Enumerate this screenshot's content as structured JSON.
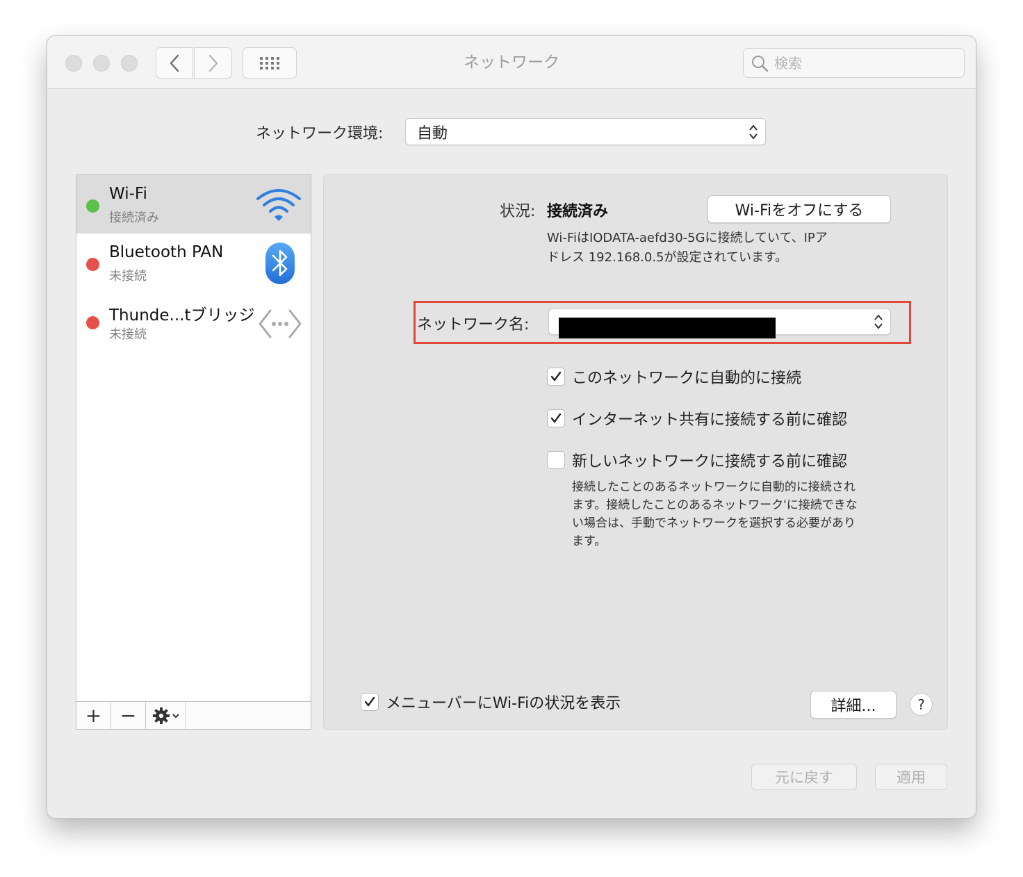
{
  "window": {
    "title": "ネットワーク"
  },
  "search": {
    "placeholder": "検索"
  },
  "location": {
    "label": "ネットワーク環境:",
    "value": "自動"
  },
  "services": [
    {
      "name": "Wi-Fi",
      "status": "接続済み",
      "dot_color": "#5cc04a",
      "icon": "wifi-icon"
    },
    {
      "name": "Bluetooth PAN",
      "status": "未接続",
      "dot_color": "#e5514a",
      "icon": "bluetooth-icon"
    },
    {
      "name": "Thunde...tブリッジ",
      "status": "未接続",
      "dot_color": "#e5514a",
      "icon": "ethernet-bridge-icon"
    }
  ],
  "sidebar_toolbar": {
    "add": "+",
    "remove": "−"
  },
  "detail": {
    "status_label": "状況:",
    "status_value": "接続済み",
    "wifi_off_button": "Wi-Fiをオフにする",
    "status_desc_line1": "Wi-FiはIODATA-aefd30-5Gに接続していて、IPア",
    "status_desc_line2": "ドレス 192.168.0.5が設定されています。",
    "network_name_label": "ネットワーク名:",
    "options": [
      {
        "label": "このネットワークに自動的に接続",
        "checked": true
      },
      {
        "label": "インターネット共有に接続する前に確認",
        "checked": true
      },
      {
        "label": "新しいネットワークに接続する前に確認",
        "checked": false
      }
    ],
    "note_lines": [
      "接続したことのあるネットワークに自動的に接続され",
      "ます。接続したことのあるネットワーク'に接続できな",
      "い場合は、手動でネットワークを選択する必要があり",
      "ます。"
    ],
    "menubar_checkbox": {
      "label": "メニューバーにWi-Fiの状況を表示",
      "checked": true
    },
    "advanced_button": "詳細...",
    "help_button": "?"
  },
  "footer": {
    "revert_button": "元に戻す",
    "apply_button": "適用"
  },
  "colors": {
    "highlight_box": "#e2473a",
    "connected": "#5cc04a",
    "disconnected": "#e5514a",
    "accent_blue": "#2f7fe0"
  }
}
